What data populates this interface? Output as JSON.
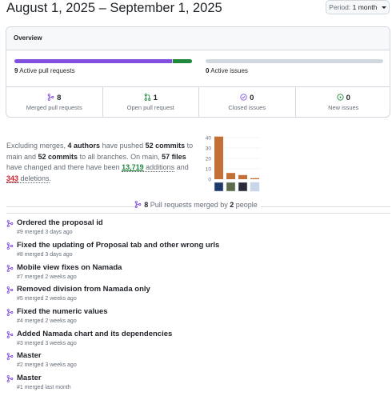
{
  "header": {
    "title": "August 1, 2025 – September 1, 2025",
    "period_label": "Period:",
    "period_value": "1 month"
  },
  "overview": {
    "heading": "Overview",
    "active_prs": {
      "count": "9",
      "label": "Active pull requests",
      "merged_fraction": 0.89,
      "open_fraction": 0.11
    },
    "active_issues": {
      "count": "0",
      "label": "Active issues"
    },
    "stats": [
      {
        "count": "8",
        "label": "Merged pull requests",
        "icon": "merge-icon"
      },
      {
        "count": "1",
        "label": "Open pull request",
        "icon": "pull-request-icon"
      },
      {
        "count": "0",
        "label": "Closed issues",
        "icon": "issue-closed-icon"
      },
      {
        "count": "0",
        "label": "New issues",
        "icon": "issue-opened-icon"
      }
    ]
  },
  "summary": {
    "t1": "Excluding merges, ",
    "authors": "4 authors",
    "t2": " have pushed ",
    "commits_main": "52 commits",
    "t3": " to main and ",
    "commits_all": "52 commits",
    "t4": " to all branches. On main, ",
    "files": "57 files",
    "t5": " have changed and there have been ",
    "additions_num": "13,719",
    "additions_word": " additions",
    "t6": " and ",
    "deletions_num": "343",
    "deletions_word": " deletions",
    "t7": "."
  },
  "chart_data": {
    "type": "bar",
    "categories": [
      "author-1",
      "author-2",
      "author-3",
      "author-4"
    ],
    "values": [
      41,
      6,
      4,
      1
    ],
    "yticks": [
      "40",
      "30",
      "20",
      "10",
      "0"
    ],
    "ylim": [
      0,
      45
    ],
    "bar_color": "#c46f35",
    "avatar_colors": [
      "#1d3a6b",
      "#5a6a4a",
      "#2a2a3a",
      "#c8d6ea"
    ]
  },
  "merged_heading": {
    "count": "8",
    "middle": " Pull requests merged by ",
    "people": "2",
    "end": " people"
  },
  "pull_requests": [
    {
      "title": "Ordered the proposal id",
      "meta": "#9 merged 3 days ago"
    },
    {
      "title": "Fixed the updating of Proposal tab and other wrong urls",
      "meta": "#8 merged 3 days ago"
    },
    {
      "title": "Mobile view fixes on Namada",
      "meta": "#7 merged 2 weeks ago"
    },
    {
      "title": "Removed division from Namada only",
      "meta": "#5 merged 2 weeks ago"
    },
    {
      "title": "Fixed the numeric values",
      "meta": "#4 merged 2 weeks ago"
    },
    {
      "title": "Added Namada chart and its dependencies",
      "meta": "#3 merged 3 weeks ago"
    },
    {
      "title": "Master",
      "meta": "#2 merged 3 weeks ago"
    },
    {
      "title": "Master",
      "meta": "#1 merged last month"
    }
  ],
  "colors": {
    "merged": "#8250df",
    "open": "#1f883d",
    "closed": "#8250df",
    "deletion": "#cf222e",
    "muted": "#656d76"
  }
}
